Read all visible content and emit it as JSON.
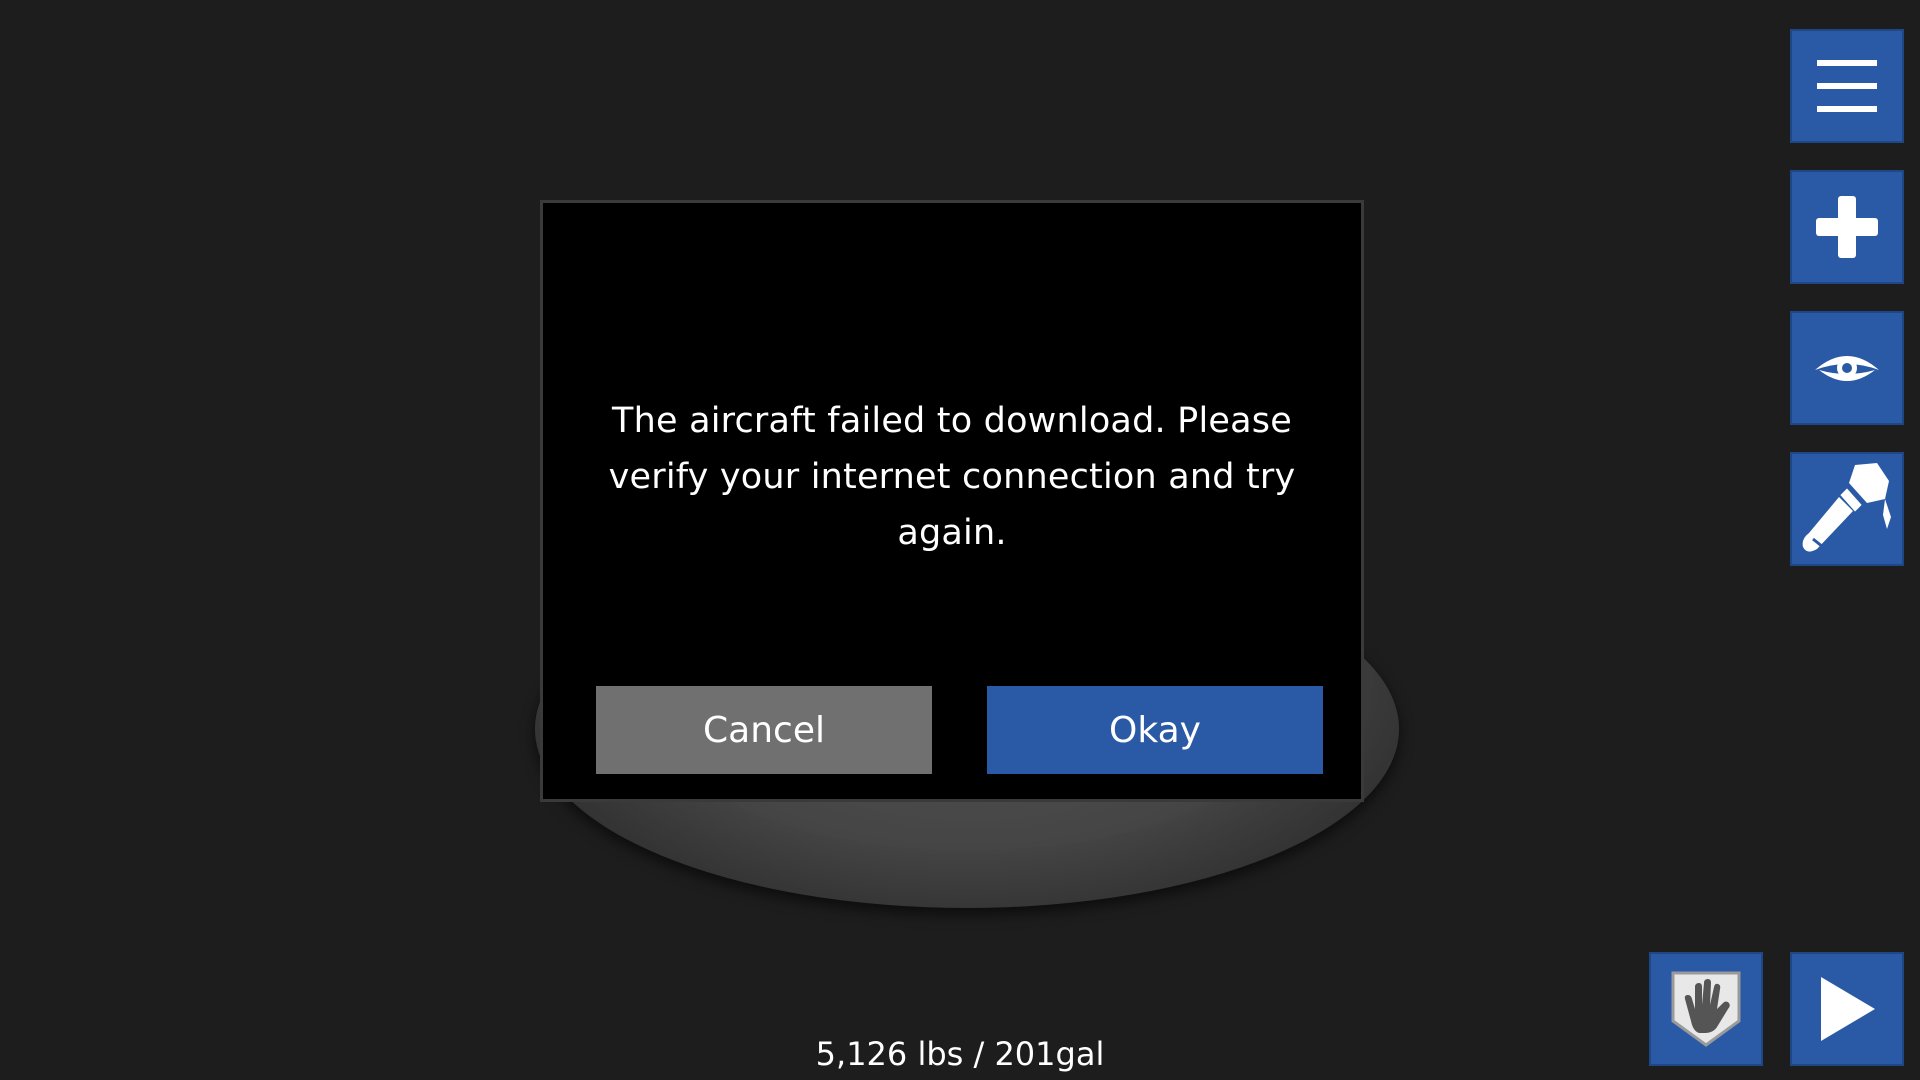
{
  "dialog": {
    "message": "The aircraft failed to download. Please verify your internet connection and try again.",
    "cancel_label": "Cancel",
    "okay_label": "Okay"
  },
  "toolbar": {
    "items": [
      {
        "name": "menu",
        "icon": "hamburger-menu-icon"
      },
      {
        "name": "add",
        "icon": "plus-icon"
      },
      {
        "name": "view",
        "icon": "eye-icon"
      },
      {
        "name": "paint",
        "icon": "paintbrush-icon"
      },
      {
        "name": "hand",
        "icon": "hand-shield-icon"
      },
      {
        "name": "play",
        "icon": "play-icon"
      }
    ]
  },
  "status": {
    "weight_fuel": "5,126 lbs / 201gal"
  },
  "colors": {
    "background": "#1d1d1d",
    "accent": "#2a5aa6",
    "cancel": "#707070",
    "dialog": "#000000"
  }
}
